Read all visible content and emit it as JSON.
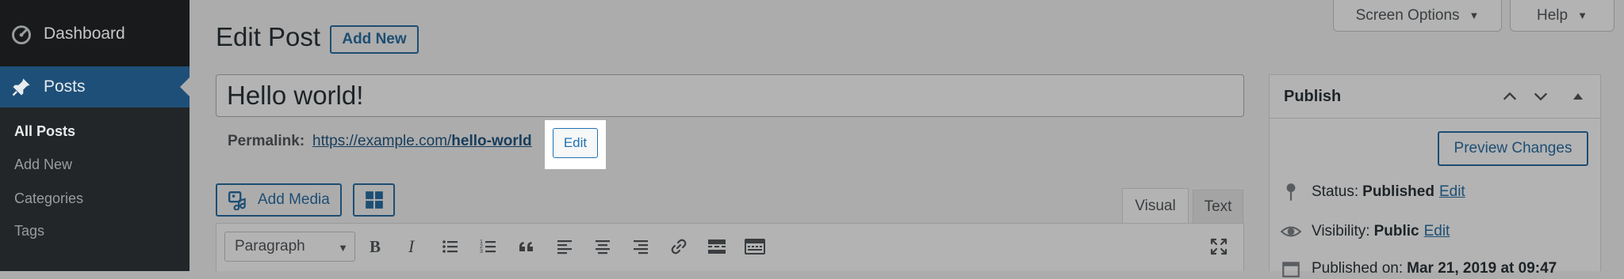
{
  "sidebar": {
    "dashboard_label": "Dashboard",
    "posts_label": "Posts",
    "submenu": [
      "All Posts",
      "Add New",
      "Categories",
      "Tags"
    ]
  },
  "top_buttons": {
    "screen_options": "Screen Options",
    "help": "Help"
  },
  "header": {
    "title": "Edit Post",
    "add_new": "Add New"
  },
  "post": {
    "title": "Hello world!",
    "permalink_label": "Permalink:",
    "permalink_base": "https://example.com/",
    "permalink_slug": "hello-world",
    "permalink_edit": "Edit"
  },
  "editor": {
    "add_media": "Add Media",
    "tabs": [
      "Visual",
      "Text"
    ],
    "format_value": "Paragraph",
    "toolbar_icons": [
      "bold-icon",
      "italic-icon",
      "bulleted-list-icon",
      "numbered-list-icon",
      "blockquote-icon",
      "align-left-icon",
      "align-center-icon",
      "align-right-icon",
      "link-icon",
      "read-more-icon",
      "toolbar-toggle-icon",
      "fullscreen-icon"
    ]
  },
  "publish": {
    "title": "Publish",
    "preview_changes": "Preview Changes",
    "status_label": "Status:",
    "status_value": "Published",
    "status_edit": "Edit",
    "visibility_label": "Visibility:",
    "visibility_value": "Public",
    "visibility_edit": "Edit",
    "published_on_label": "Published on:",
    "published_on_value": "Mar 21, 2019 at 09:47"
  },
  "colors": {
    "sidebar_bg": "#181a1b",
    "posts_active_bg": "#1e4f78",
    "accent": "#2271b1"
  }
}
